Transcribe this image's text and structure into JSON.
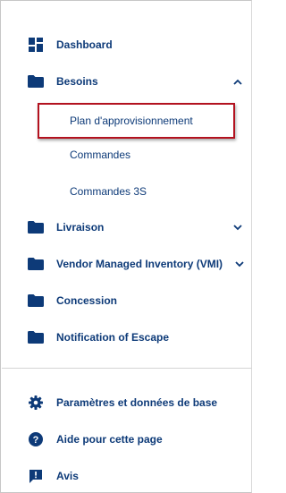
{
  "sidebar": {
    "items": [
      {
        "label": "Dashboard",
        "icon": "dashboard-icon"
      },
      {
        "label": "Besoins",
        "icon": "folder-icon",
        "expanded": true,
        "children": [
          {
            "label": "Plan d'approvisionnement",
            "highlighted": true
          },
          {
            "label": "Commandes"
          },
          {
            "label": "Commandes 3S"
          }
        ]
      },
      {
        "label": "Livraison",
        "icon": "folder-icon",
        "expanded": false
      },
      {
        "label": "Vendor Managed Inventory (VMI)",
        "icon": "folder-icon",
        "expanded": false
      },
      {
        "label": "Concession",
        "icon": "folder-icon"
      },
      {
        "label": "Notification of Escape",
        "icon": "folder-icon"
      }
    ],
    "footer": [
      {
        "label": "Paramètres et données de base",
        "icon": "gear-icon"
      },
      {
        "label": "Aide pour cette page",
        "icon": "help-icon"
      },
      {
        "label": "Avis",
        "icon": "feedback-icon"
      }
    ]
  },
  "colors": {
    "text": "#0d3a78",
    "highlight_border": "#b3121f"
  }
}
